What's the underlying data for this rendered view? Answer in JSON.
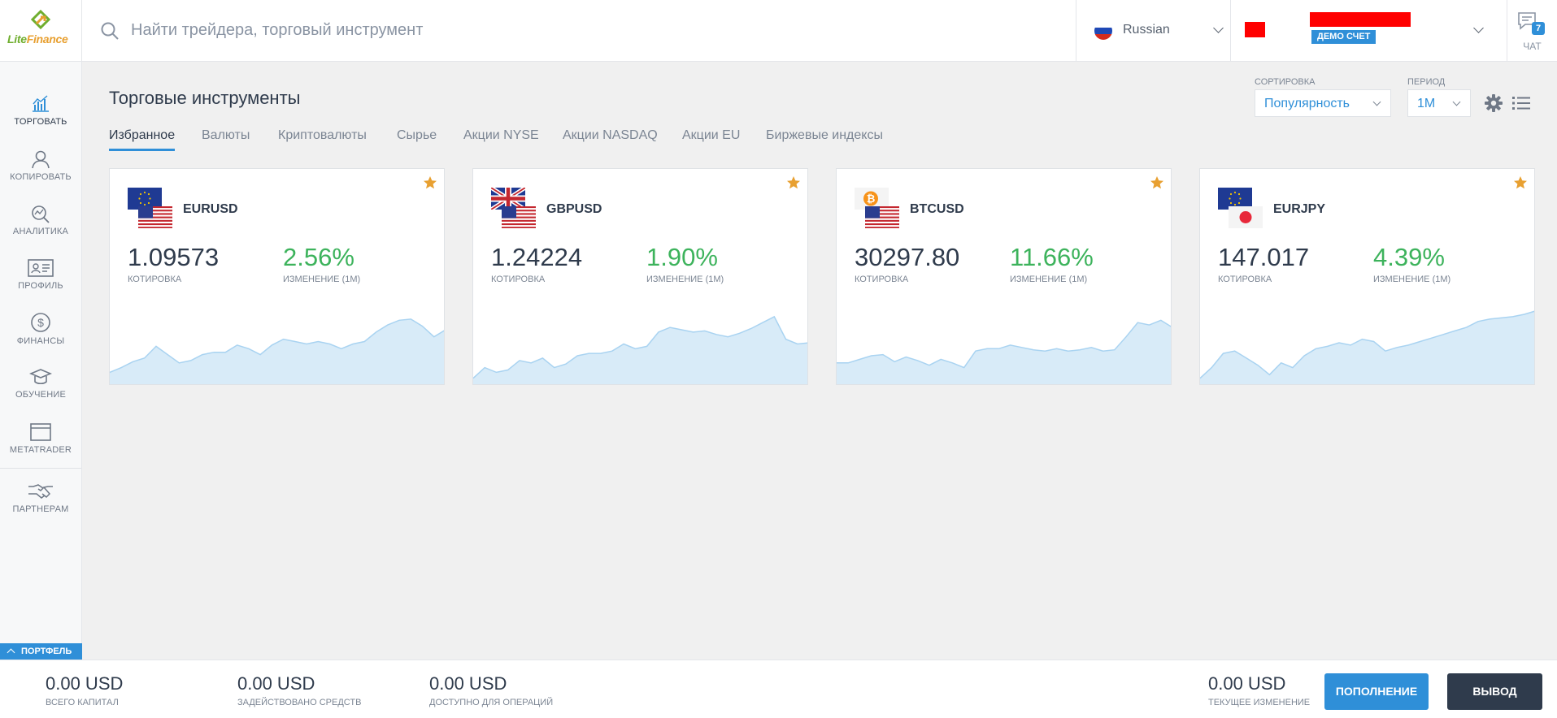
{
  "brand": {
    "name_part1": "Lite",
    "name_part2": "Finance"
  },
  "search": {
    "placeholder": "Найти трейдера, торговый инструмент",
    "icon": "search-icon"
  },
  "language": {
    "label": "Russian",
    "icon": "flag-ru-icon"
  },
  "account": {
    "badge": "ДЕМО СЧЕТ"
  },
  "chat": {
    "label": "ЧАТ",
    "count": "7"
  },
  "sidebar": {
    "items": [
      {
        "label": "ТОРГОВАТЬ",
        "icon": "chart-icon"
      },
      {
        "label": "КОПИРОВАТЬ",
        "icon": "user-icon"
      },
      {
        "label": "АНАЛИТИКА",
        "icon": "analytics-icon"
      },
      {
        "label": "ПРОФИЛЬ",
        "icon": "id-card-icon"
      },
      {
        "label": "ФИНАНСЫ",
        "icon": "dollar-icon"
      },
      {
        "label": "ОБУЧЕНИЕ",
        "icon": "graduation-cap-icon"
      },
      {
        "label": "METATRADER",
        "icon": "window-icon"
      },
      {
        "label": "ПАРТНЕРАМ",
        "icon": "handshake-icon"
      }
    ],
    "portfolio_label": "ПОРТФЕЛЬ"
  },
  "main": {
    "title": "Торговые инструменты",
    "tabs": [
      "Избранное",
      "Валюты",
      "Криптовалюты",
      "Сырье",
      "Акции NYSE",
      "Акции NASDAQ",
      "Акции EU",
      "Биржевые индексы"
    ],
    "active_tab": "Избранное",
    "sort": {
      "label": "СОРТИРОВКА",
      "value": "Популярность"
    },
    "period": {
      "label": "ПЕРИОД",
      "value": "1M"
    }
  },
  "cards": [
    {
      "symbol": "EURUSD",
      "quote": "1.09573",
      "quote_label": "КОТИРОВКА",
      "change": "2.56%",
      "change_label": "ИЗМЕНЕНИЕ (1М)",
      "spark": [
        10,
        14,
        19,
        22,
        32,
        25,
        18,
        20,
        25,
        27,
        27,
        33,
        30,
        25,
        33,
        38,
        36,
        34,
        36,
        34,
        30,
        34,
        36,
        44,
        50,
        54,
        55,
        49,
        40,
        46
      ]
    },
    {
      "symbol": "GBPUSD",
      "quote": "1.24224",
      "quote_label": "КОТИРОВКА",
      "change": "1.90%",
      "change_label": "ИЗМЕНЕНИЕ (1М)",
      "spark": [
        5,
        14,
        10,
        12,
        20,
        18,
        22,
        14,
        17,
        24,
        26,
        26,
        28,
        34,
        30,
        32,
        44,
        48,
        46,
        44,
        45,
        42,
        40,
        43,
        47,
        52,
        57,
        38,
        34,
        35
      ]
    },
    {
      "symbol": "BTCUSD",
      "quote": "30297.80",
      "quote_label": "КОТИРОВКА",
      "change": "11.66%",
      "change_label": "ИЗМЕНЕНИЕ (1М)",
      "spark": [
        18,
        18,
        21,
        24,
        25,
        19,
        23,
        20,
        16,
        21,
        18,
        14,
        28,
        30,
        30,
        33,
        31,
        29,
        28,
        30,
        28,
        29,
        31,
        28,
        29,
        40,
        52,
        50,
        54,
        48
      ]
    },
    {
      "symbol": "EURJPY",
      "quote": "147.017",
      "quote_label": "КОТИРОВКА",
      "change": "4.39%",
      "change_label": "ИЗМЕНЕНИЕ (1М)",
      "spark": [
        5,
        14,
        26,
        28,
        22,
        16,
        8,
        18,
        14,
        24,
        30,
        32,
        35,
        33,
        38,
        36,
        28,
        31,
        33,
        36,
        39,
        42,
        45,
        48,
        53,
        55,
        56,
        57,
        59,
        62
      ]
    }
  ],
  "footer": {
    "total_capital": {
      "value": "0.00 USD",
      "label": "ВСЕГО КАПИТАЛ"
    },
    "used_funds": {
      "value": "0.00 USD",
      "label": "ЗАДЕЙСТВОВАНО СРЕДСТВ"
    },
    "available": {
      "value": "0.00 USD",
      "label": "ДОСТУПНО ДЛЯ ОПЕРАЦИЙ"
    },
    "current_change": {
      "value": "0.00 USD",
      "label": "ТЕКУЩЕЕ ИЗМЕНЕНИЕ"
    },
    "deposit_label": "ПОПОЛНЕНИЕ",
    "withdraw_label": "ВЫВОД"
  },
  "colors": {
    "accent": "#2f8fd8",
    "positive": "#3db35c",
    "star": "#e8a031",
    "dark": "#2f3b4c"
  }
}
